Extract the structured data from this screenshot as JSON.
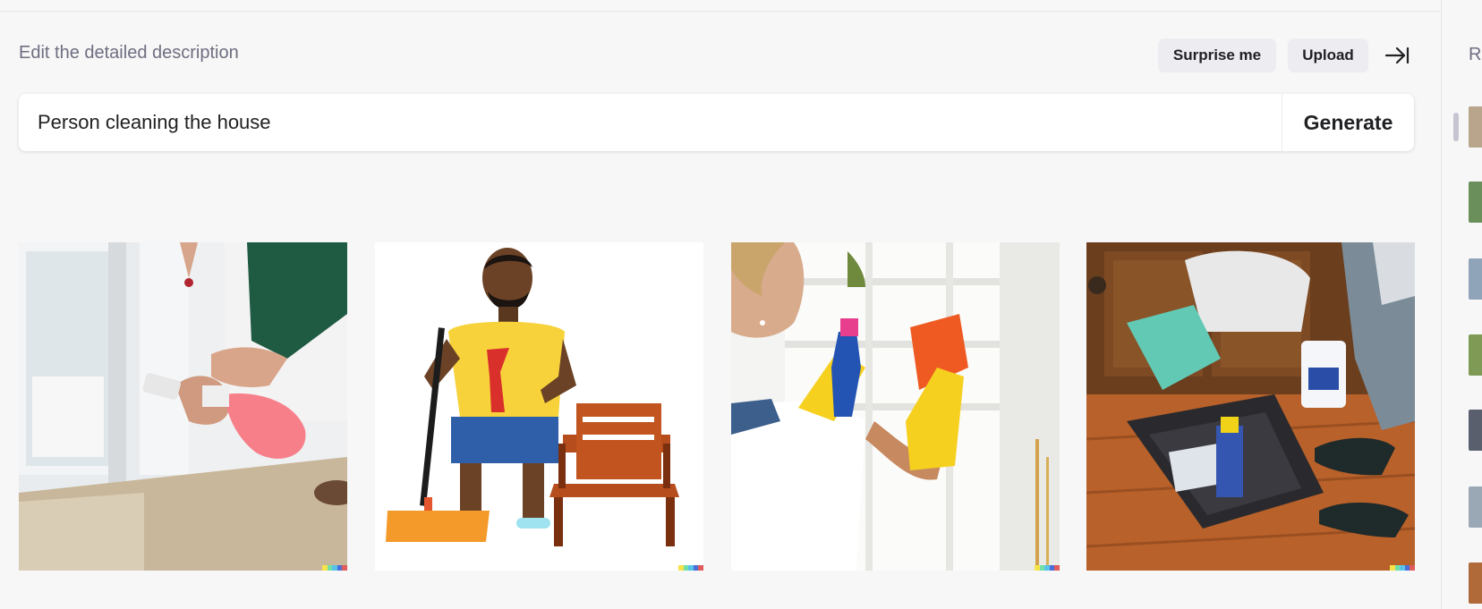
{
  "editor": {
    "heading": "Edit the detailed description",
    "surprise_label": "Surprise me",
    "upload_label": "Upload",
    "prompt_value": "Person cleaning the house",
    "generate_label": "Generate"
  },
  "results": {
    "images": [
      {
        "name": "spray-door-photo",
        "alt": "Hand spraying pink spray bottle at door"
      },
      {
        "name": "man-broom-illustration",
        "alt": "Illustration of man with broom and chair"
      },
      {
        "name": "woman-gloves-photo",
        "alt": "Woman in yellow gloves cleaning shelf"
      },
      {
        "name": "basket-floor-photo",
        "alt": "People with cleaning basket on wood floor"
      }
    ],
    "signature_colors": [
      "#f6e34a",
      "#71dfa7",
      "#58c3e8",
      "#4b6fd8",
      "#e05b5b"
    ]
  },
  "sidebar": {
    "title": "R",
    "thumb_colors": [
      "#b8a58c",
      "#6b8f5a",
      "#8fa3b9",
      "#7e9a55",
      "#5a5f6e",
      "#9aa7b4",
      "#b06a3a"
    ]
  },
  "icons": {
    "collapse": "arrow-right-to-bar-icon"
  }
}
